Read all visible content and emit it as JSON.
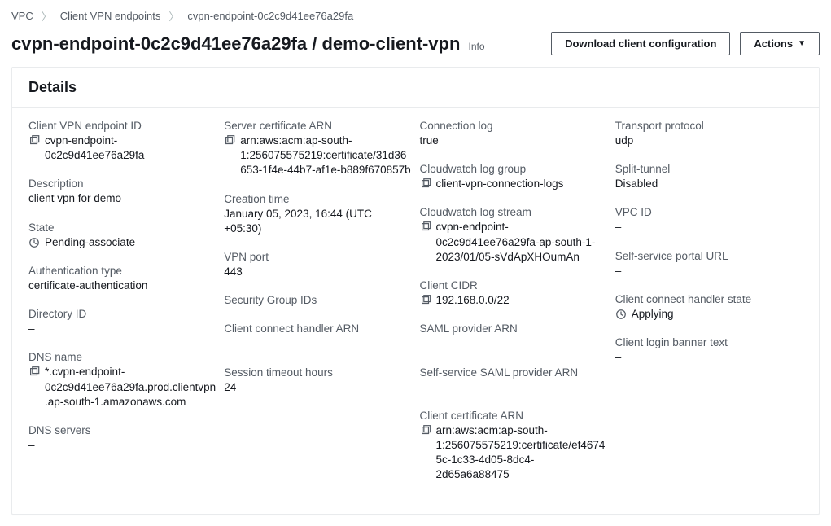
{
  "breadcrumb": {
    "root": "VPC",
    "mid": "Client VPN endpoints",
    "leaf": "cvpn-endpoint-0c2c9d41ee76a29fa"
  },
  "header": {
    "title": "cvpn-endpoint-0c2c9d41ee76a29fa / demo-client-vpn",
    "info": "Info",
    "download": "Download client configuration",
    "actions": "Actions"
  },
  "panel": {
    "title": "Details"
  },
  "col1": {
    "endpoint_id_label": "Client VPN endpoint ID",
    "endpoint_id": "cvpn-endpoint-0c2c9d41ee76a29fa",
    "description_label": "Description",
    "description": "client vpn for demo",
    "state_label": "State",
    "state": "Pending-associate",
    "auth_type_label": "Authentication type",
    "auth_type": "certificate-authentication",
    "directory_id_label": "Directory ID",
    "directory_id": "–",
    "dns_name_label": "DNS name",
    "dns_name": "*.cvpn-endpoint-0c2c9d41ee76a29fa.prod.clientvpn.ap-south-1.amazonaws.com",
    "dns_servers_label": "DNS servers",
    "dns_servers": "–"
  },
  "col2": {
    "server_cert_label": "Server certificate ARN",
    "server_cert": "arn:aws:acm:ap-south-1:256075575219:certificate/31d36653-1f4e-44b7-af1e-b889f670857b",
    "creation_time_label": "Creation time",
    "creation_time": "January 05, 2023, 16:44 (UTC +05:30)",
    "vpn_port_label": "VPN port",
    "vpn_port": "443",
    "sg_ids_label": "Security Group IDs",
    "sg_ids": "",
    "cch_arn_label": "Client connect handler ARN",
    "cch_arn": "–",
    "timeout_label": "Session timeout hours",
    "timeout": "24"
  },
  "col3": {
    "conn_log_label": "Connection log",
    "conn_log": "true",
    "cw_group_label": "Cloudwatch log group",
    "cw_group": "client-vpn-connection-logs",
    "cw_stream_label": "Cloudwatch log stream",
    "cw_stream": "cvpn-endpoint-0c2c9d41ee76a29fa-ap-south-1-2023/01/05-sVdApXHOumAn",
    "client_cidr_label": "Client CIDR",
    "client_cidr": "192.168.0.0/22",
    "saml_label": "SAML provider ARN",
    "saml": "–",
    "ss_saml_label": "Self-service SAML provider ARN",
    "ss_saml": "–",
    "client_cert_label": "Client certificate ARN",
    "client_cert": "arn:aws:acm:ap-south-1:256075575219:certificate/ef46745c-1c33-4d05-8dc4-2d65a6a88475"
  },
  "col4": {
    "transport_label": "Transport protocol",
    "transport": "udp",
    "split_label": "Split-tunnel",
    "split": "Disabled",
    "vpc_id_label": "VPC ID",
    "vpc_id": "–",
    "ss_portal_label": "Self-service portal URL",
    "ss_portal": "–",
    "cch_state_label": "Client connect handler state",
    "cch_state": "Applying",
    "banner_label": "Client login banner text",
    "banner": "–"
  }
}
